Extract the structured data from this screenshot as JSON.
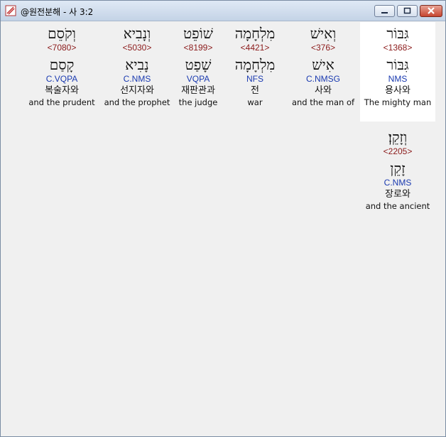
{
  "window": {
    "title": "@원전분해 - 사 3:2"
  },
  "words": [
    {
      "hebrew": "גִּבּוֹר",
      "strong": "<1368>",
      "lemma": "גִּבּוֹר",
      "morph": "NMS",
      "korean": "용사와",
      "english": "The mighty man",
      "highlighted": true
    },
    {
      "hebrew": "וְאִישׁ",
      "strong": "<376>",
      "lemma": "אִישׁ",
      "morph": "C.NMSG",
      "korean": "사와",
      "english": "and the man of"
    },
    {
      "hebrew": "מִלְחָמָה",
      "strong": "<4421>",
      "lemma": "מִלְחָמָה",
      "morph": "NFS",
      "korean": "전",
      "english": "war"
    },
    {
      "hebrew": "שׁוֹפֵט",
      "strong": "<8199>",
      "lemma": "שָׁפַט",
      "morph": "VQPA",
      "korean": "재판관과",
      "english": "the judge"
    },
    {
      "hebrew": "וְנָבִיא",
      "strong": "<5030>",
      "lemma": "נָבִיא",
      "morph": "C.NMS",
      "korean": "선지자와",
      "english": "and the prophet"
    },
    {
      "hebrew": "וְקֹסֵם",
      "strong": "<7080>",
      "lemma": "קָסַם",
      "morph": "C.VQPA",
      "korean": "복술자와",
      "english": "and the prudent"
    },
    {
      "hebrew": "וְזָקֵן׃",
      "strong": "<2205>",
      "lemma": "זָקֵן",
      "morph": "C.NMS",
      "korean": "장로와",
      "english": "and the ancient"
    }
  ]
}
